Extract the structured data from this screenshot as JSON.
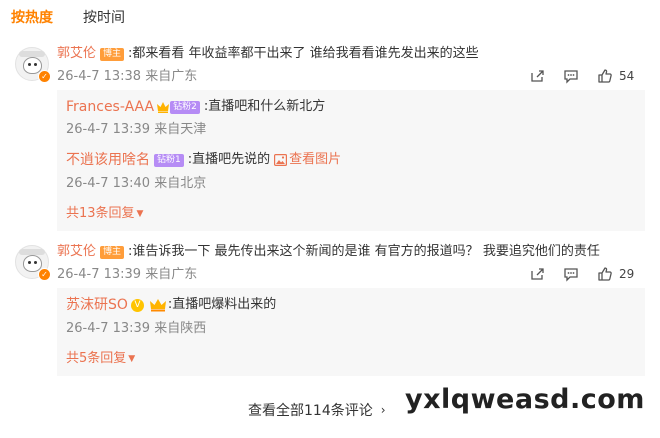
{
  "tabs": {
    "hot": "按热度",
    "time": "按时间"
  },
  "comments": [
    {
      "user": "郭艾伦",
      "tag": "博主",
      "text": "都来看看 年收益率都干出来了 谁给我看看谁先发出来的这些",
      "time": "26-4-7 13:38",
      "location": "来自广东",
      "likes": "54",
      "replies": [
        {
          "user": "Frances-AAA",
          "tag": "钻粉2",
          "text": "直播吧和什么新北方",
          "time": "26-4-7 13:39",
          "location": "来自天津"
        },
        {
          "user": "不逍该用啥名",
          "tag": "钻粉1",
          "text": "直播吧先说的",
          "picture": "查看图片",
          "time": "26-4-7 13:40",
          "location": "来自北京"
        }
      ],
      "more": "共13条回复"
    },
    {
      "user": "郭艾伦",
      "tag": "博主",
      "text": "谁告诉我一下 最先传出来这个新闻的是谁 有官方的报道吗？ 我要追究他们的责任",
      "time": "26-4-7 13:39",
      "location": "来自广东",
      "likes": "29",
      "replies": [
        {
          "user": "苏沫研SO",
          "text": "直播吧爆料出来的",
          "time": "26-4-7 13:39",
          "location": "来自陕西"
        }
      ],
      "more": "共5条回复"
    }
  ],
  "view_all": "查看全部114条评论",
  "watermark": "yxlqweasd.com",
  "colors": {
    "accent": "#ff8200",
    "username": "#eb7350",
    "reply_bg": "#f7f7f7"
  }
}
